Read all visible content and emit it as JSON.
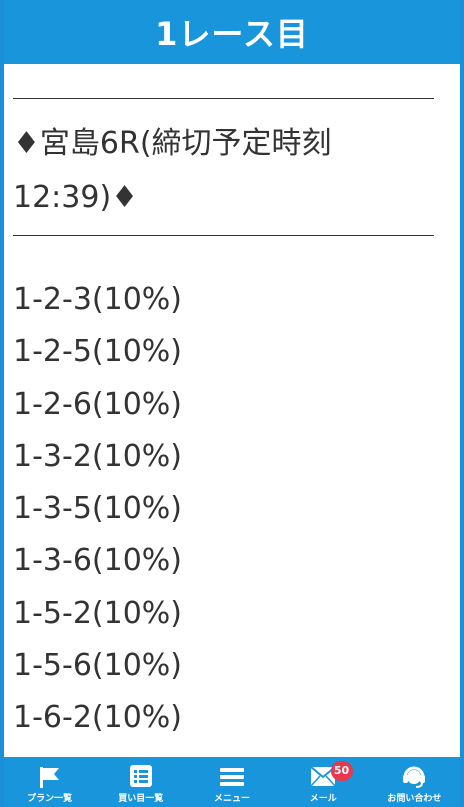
{
  "header": {
    "title": "1レース目"
  },
  "content": {
    "race_line1": "♦宮島6R(締切予定時刻",
    "race_line2": "12:39)♦",
    "bets": [
      "1-2-3(10%)",
      "1-2-5(10%)",
      "1-2-6(10%)",
      "1-3-2(10%)",
      "1-3-5(10%)",
      "1-3-6(10%)",
      "1-5-2(10%)",
      "1-5-6(10%)",
      "1-6-2(10%)"
    ]
  },
  "nav": {
    "items": [
      {
        "label": "プラン一覧",
        "icon": "flag-icon"
      },
      {
        "label": "買い目一覧",
        "icon": "list-icon"
      },
      {
        "label": "メニュー",
        "icon": "menu-icon"
      },
      {
        "label": "メール",
        "icon": "mail-icon",
        "badge": "50"
      },
      {
        "label": "お問い合わせ",
        "icon": "headset-icon"
      }
    ]
  },
  "colors": {
    "brand_blue": "#1996db",
    "badge_red": "#e8384f",
    "text": "#333333"
  }
}
